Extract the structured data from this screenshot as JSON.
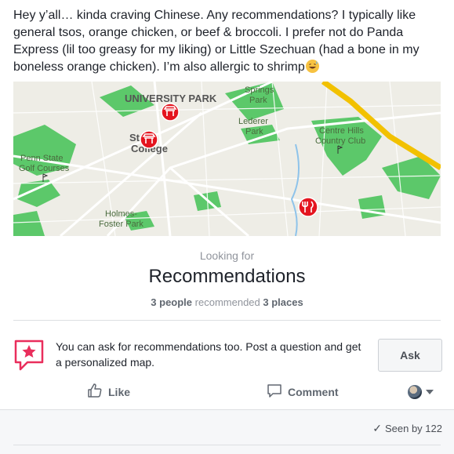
{
  "post": {
    "text": "Hey y’all… kinda craving Chinese. Any recommendations? I typically like general tsos, orange chicken, or beef & broccoli. I prefer not do Panda Express (lil too greasy for my liking) or Little Szechuan (had a bone in my boneless orange chicken). I’m also allergic to shrimp",
    "emoji": "grinning-sweat-emoji"
  },
  "map": {
    "labels": {
      "university_park": "UNIVERSITY PARK",
      "state_college_1": "State",
      "state_college_2": "College",
      "springs_park_1": "Springs",
      "springs_park_2": "Park",
      "lederer_park_1": "Lederer",
      "lederer_park_2": "Park",
      "centre_hills_1": "Centre Hills",
      "centre_hills_2": "Country Club",
      "penn_state_1": "Penn State",
      "penn_state_2": "Golf Courses",
      "holmes_1": "Holmes-",
      "holmes_2": "Foster Park"
    },
    "pins": [
      "chinese-restaurant-pin",
      "chinese-restaurant-pin",
      "restaurant-pin"
    ],
    "colors": {
      "pin": "#e4151f",
      "park": "#5cc86a",
      "highway": "#f2c100"
    }
  },
  "recommendations": {
    "looking_for": "Looking for",
    "title": "Recommendations",
    "people_count": "3 people",
    "recommended_word": "recommended",
    "places_count": "3 places"
  },
  "ask": {
    "text": "You can ask for recommendations too. Post a question and get a personalized map.",
    "button_label": "Ask",
    "icon": "star-speech-bubble-icon"
  },
  "actions": {
    "like_label": "Like",
    "comment_label": "Comment"
  },
  "footer": {
    "seen_by": "Seen by 122"
  },
  "colors": {
    "accent_pink": "#e92e5c",
    "text": "#1d2129",
    "muted": "#90949c"
  }
}
